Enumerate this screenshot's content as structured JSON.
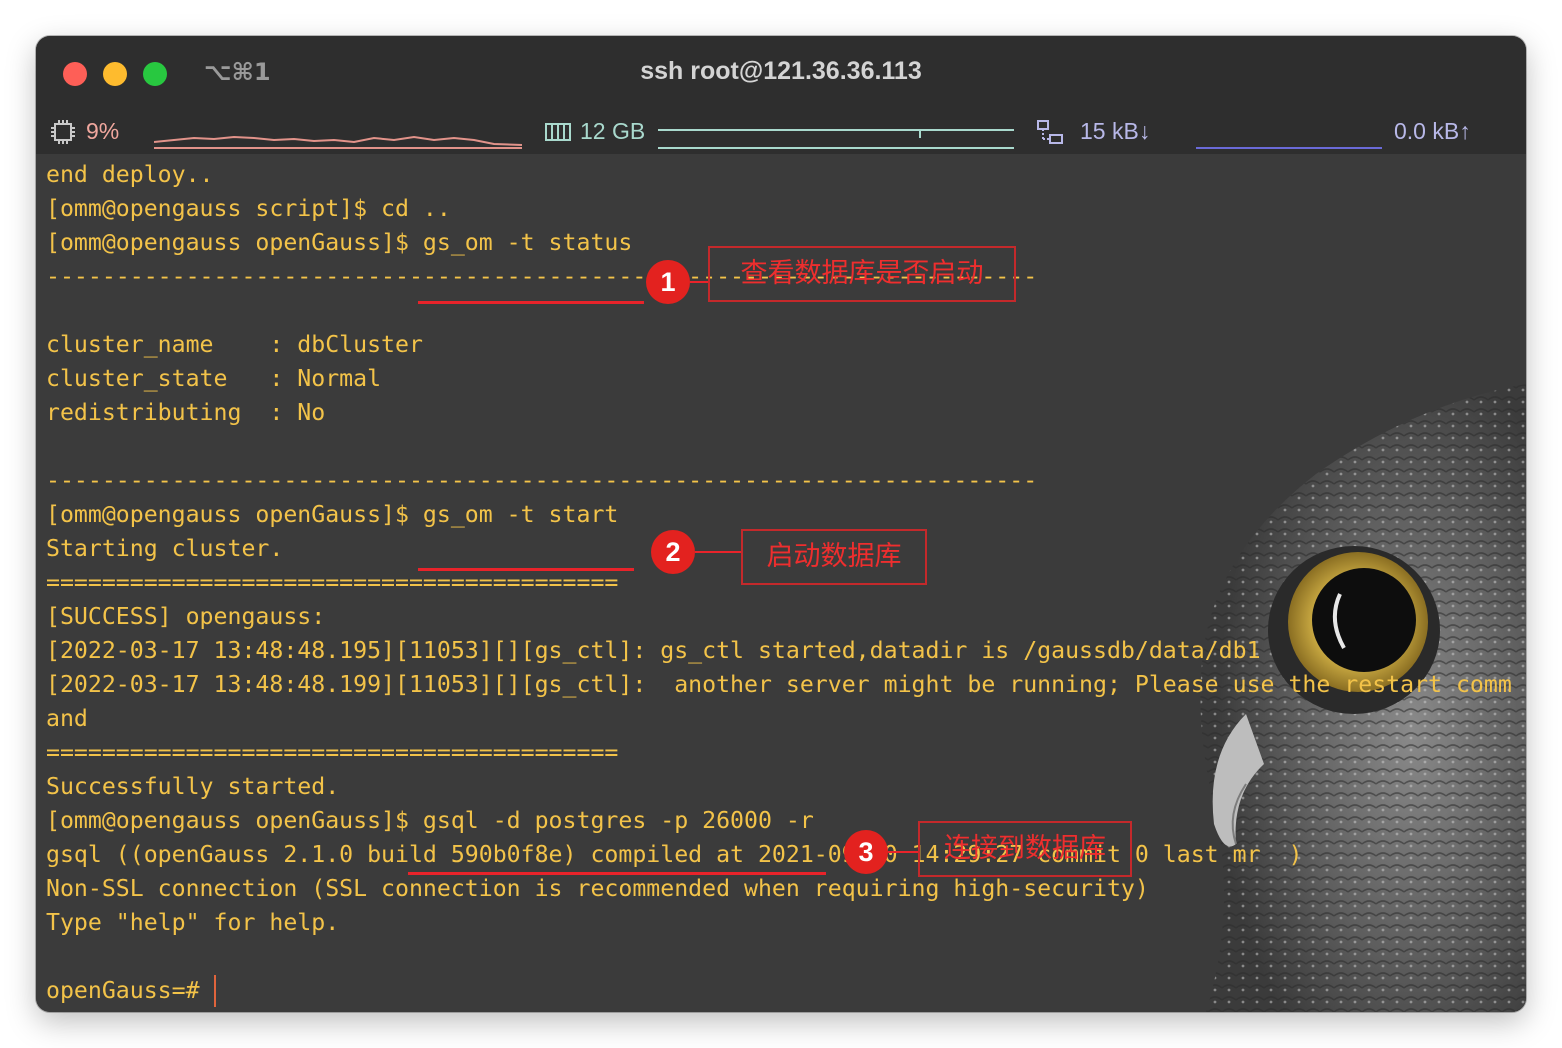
{
  "window": {
    "title": "ssh root@121.36.36.113",
    "shortcut": "⌥⌘1"
  },
  "statusbar": {
    "cpu": "9%",
    "memory": "12 GB",
    "net_down": "15 kB↓",
    "net_up": "0.0 kB↑"
  },
  "terminal": {
    "lines": [
      "end deploy..",
      "[omm@opengauss script]$ cd ..",
      "[omm@opengauss openGauss]$ gs_om -t status",
      "-----------------------------------------------------------------------",
      "",
      "cluster_name    : dbCluster",
      "cluster_state   : Normal",
      "redistributing  : No",
      "",
      "-----------------------------------------------------------------------",
      "[omm@opengauss openGauss]$ gs_om -t start",
      "Starting cluster.",
      "=========================================",
      "[SUCCESS] opengauss:",
      "[2022-03-17 13:48:48.195][11053][][gs_ctl]: gs_ctl started,datadir is /gaussdb/data/db1",
      "[2022-03-17 13:48:48.199][11053][][gs_ctl]:  another server might be running; Please use the restart comm",
      "and",
      "=========================================",
      "Successfully started.",
      "[omm@opengauss openGauss]$ gsql -d postgres -p 26000 -r",
      "gsql ((openGauss 2.1.0 build 590b0f8e) compiled at 2021-09-30 14:29:27 commit 0 last mr  )",
      "Non-SSL connection (SSL connection is recommended when requiring high-security)",
      "Type \"help\" for help.",
      "",
      "openGauss=# "
    ]
  },
  "annotations": [
    {
      "number": "1",
      "label": "查看数据库是否启动"
    },
    {
      "number": "2",
      "label": "启动数据库"
    },
    {
      "number": "3",
      "label": "连接到数据库"
    }
  ],
  "colors": {
    "terminal_text": "#f3c349",
    "annotation_red": "#e3221f",
    "terminal_bg": "#3b3b3b"
  }
}
